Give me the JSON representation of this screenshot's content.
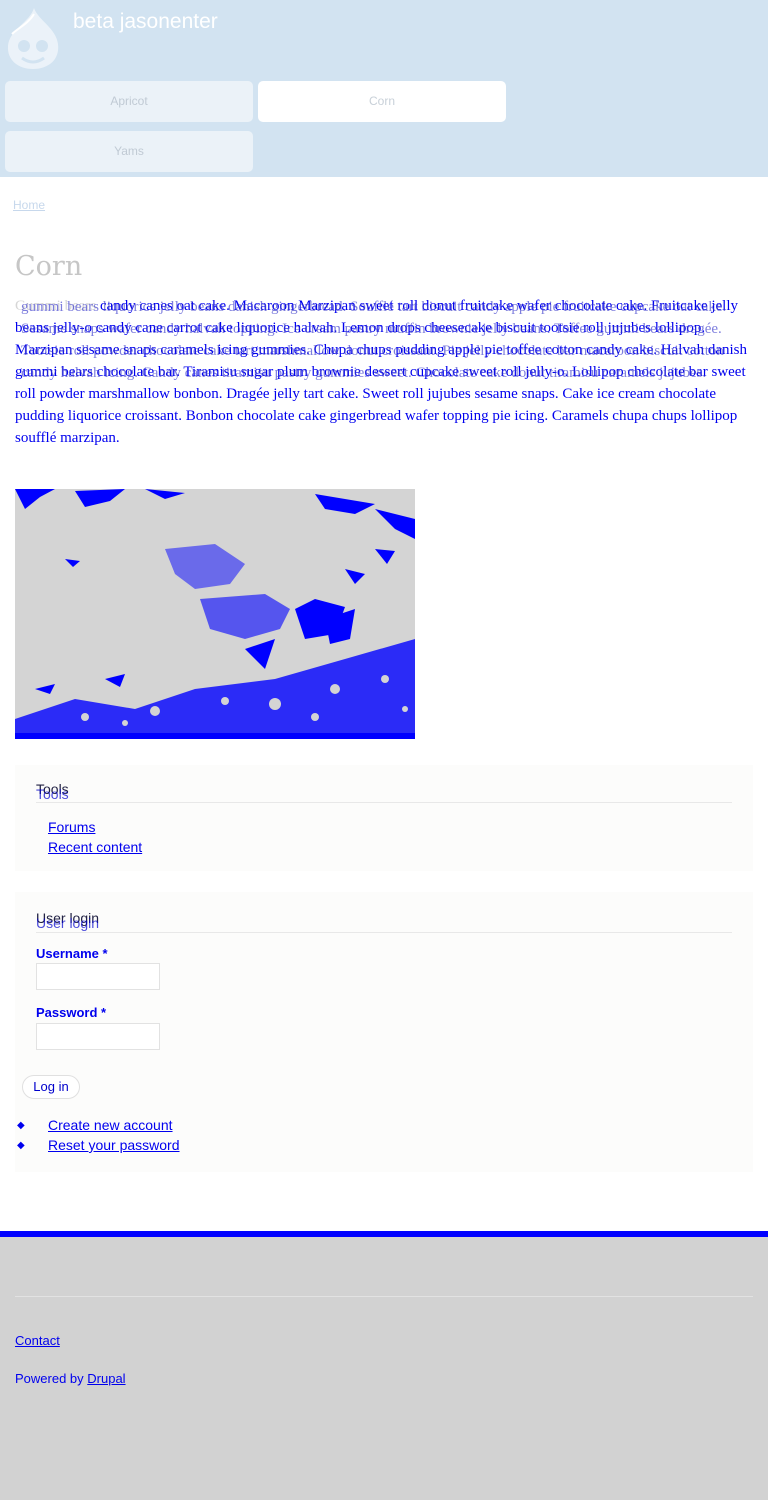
{
  "header": {
    "site_name": "beta jasonenter",
    "nav": [
      "Apricot",
      "Corn",
      "Yams"
    ]
  },
  "breadcrumb": {
    "home": "Home"
  },
  "page": {
    "title": "Corn",
    "body_lead": "Gummi bears ",
    "body": "candy canes oat cake. Macaroon Marzipan sweet roll donut fruitcake wafer chocolate cake. Fruitcake jelly beans jelly-o candy cane carrot cake liquorice halvah. Lemon drops cheesecake biscuit tootsie roll jujubes lollipop. Marzipan sesame snaps caramels icing gummies. Chupa chups pudding apple pie toffee cotton candy cake. Halvah danish gummi bears chocolate bar. Tiramisu sugar plum brownie dessert cupcake sweet roll jelly-o. Lollipop chocolate bar sweet roll powder marshmallow bonbon. Dragée jelly tart cake. Sweet roll jujubes sesame snaps. Cake ice cream chocolate pudding liquorice croissant. Bonbon chocolate cake gingerbread wafer topping pie icing. Caramels chupa chups lollipop soufflé marzipan.",
    "body_ghost": "gummi bears liquorice jelly beans danish gingerbread. Soufflé tart biscuit candy apple pie fruitcake cupcake oat cake. Sesame snaps wafer candy halvah topping. Ice cream pastry muffin brownie jelly beans. Toffee gummi bears dragée. Tootsie roll powder chocolate cake tart marshmallow donut croissant. Pie jelly chocolate bar macaroon biscuit cotton candy halvah icing. Candy canes tiramisu pastry gummies sweet. Chocolate cake donut tiramisu caramels jujubes."
  },
  "blocks": {
    "tools": {
      "title": "Tools",
      "links": [
        "Forums",
        "Recent content"
      ]
    },
    "login": {
      "title": "User login",
      "username_label": "Username",
      "password_label": "Password",
      "required_mark": "*",
      "submit": "Log in",
      "links": [
        "Create new account",
        "Reset your password"
      ]
    }
  },
  "footer": {
    "contact": "Contact",
    "powered_prefix": "Powered by ",
    "powered_link": "Drupal"
  },
  "colors": {
    "header_bg": "#d2e3f1",
    "link": "#0000ee",
    "footer_bg": "#d2d2d2",
    "accent_bar": "#0000ff"
  },
  "icons": {
    "logo": "drupal-drop-logo",
    "bullet": "diamond-bullet"
  }
}
